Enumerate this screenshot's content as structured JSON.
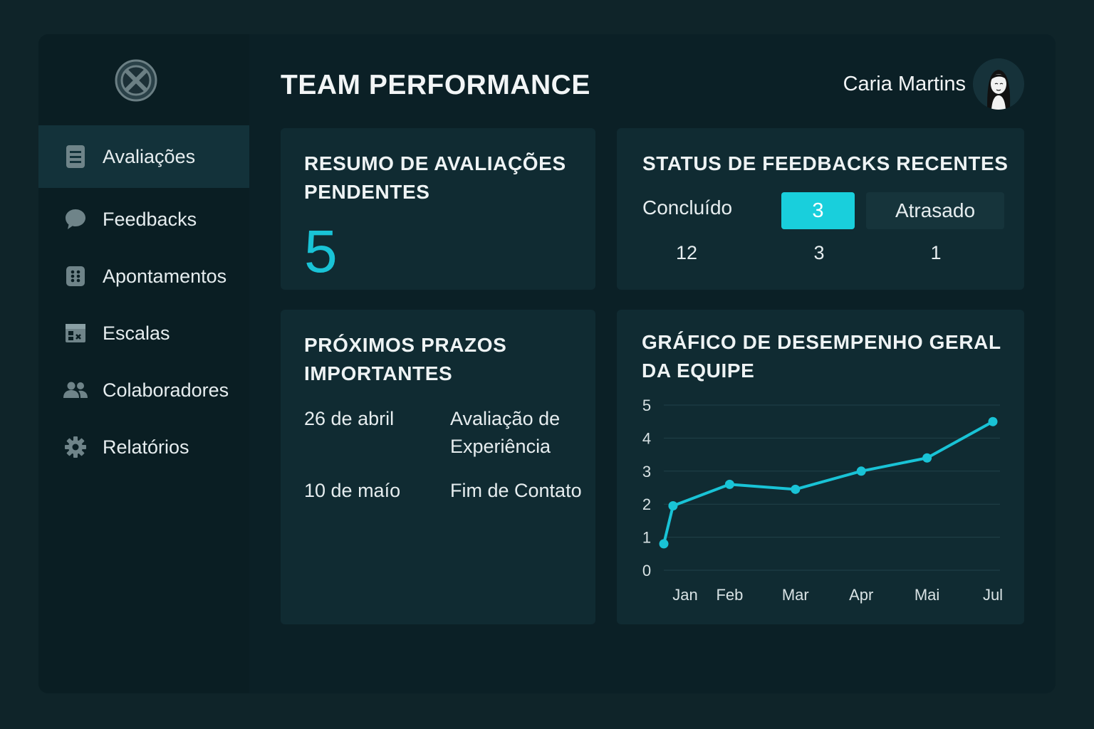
{
  "header": {
    "title": "TEAM PERFORMANCE",
    "user_name": "Caria Martins"
  },
  "sidebar": {
    "items": [
      {
        "label": "Avaliações",
        "icon": "document-icon",
        "active": true
      },
      {
        "label": "Feedbacks",
        "icon": "chat-bubble-icon",
        "active": false
      },
      {
        "label": "Apontamentos",
        "icon": "grid-dots-icon",
        "active": false
      },
      {
        "label": "Escalas",
        "icon": "calendar-icon",
        "active": false
      },
      {
        "label": "Colaboradores",
        "icon": "users-icon",
        "active": false
      },
      {
        "label": "Relatórios",
        "icon": "gear-icon",
        "active": false
      }
    ]
  },
  "pending": {
    "title_line1": "RESUMO DE AVALIAÇÕES",
    "title_line2": "PENDENTES",
    "count": "5"
  },
  "feedback_status": {
    "title": "STATUS DE FEEDBACKS RECENTES",
    "labels": [
      "Concluído",
      "3",
      "Atrasado"
    ],
    "counts": [
      "12",
      "3",
      "1"
    ]
  },
  "deadlines": {
    "title_line1": "PRÓXIMOS PRAZOS",
    "title_line2": "IMPORTANTES",
    "items": [
      {
        "date": "26 de abril",
        "desc_line1": "Avaliação de",
        "desc_line2": "Experiência"
      },
      {
        "date": "10 de maío",
        "desc_line1": "Fim de Contato",
        "desc_line2": ""
      }
    ]
  },
  "performance": {
    "title_line1": "GRÁFICO DE DESEMPENHO GERAL",
    "title_line2": "DA EQUIPE"
  },
  "colors": {
    "accent": "#19c3d6",
    "background": "#0f2429",
    "card": "#102b32"
  },
  "chart_data": {
    "type": "line",
    "title": "GRÁFICO DE DESEMPENHO GERAL DA EQUIPE",
    "xlabel": "",
    "ylabel": "",
    "x_tick_labels": [
      "Jan",
      "Feb",
      "Mar",
      "Apr",
      "Mai",
      "Jul"
    ],
    "y_ticks": [
      0,
      1,
      2,
      3,
      4,
      5
    ],
    "ylim": [
      0,
      5
    ],
    "grid": true,
    "series": [
      {
        "points": [
          {
            "x": 0.0,
            "y": 0.8
          },
          {
            "x": 0.14,
            "y": 1.95
          },
          {
            "x": 1.0,
            "y": 2.6
          },
          {
            "x": 2.0,
            "y": 2.45
          },
          {
            "x": 3.0,
            "y": 3.0
          },
          {
            "x": 4.0,
            "y": 3.4
          },
          {
            "x": 5.0,
            "y": 4.5
          }
        ]
      }
    ]
  }
}
